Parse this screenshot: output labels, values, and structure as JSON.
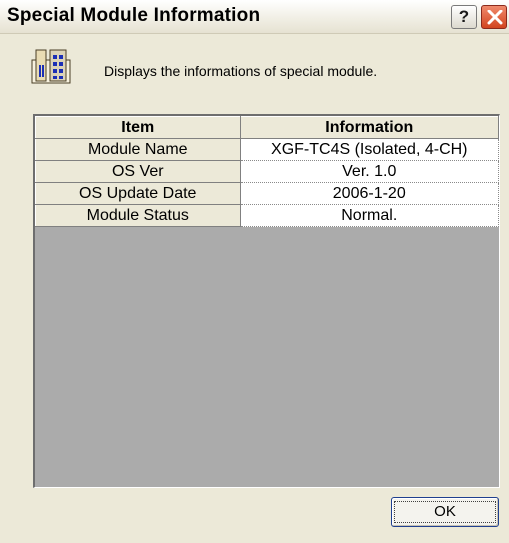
{
  "window": {
    "title": "Special Module Information",
    "help_glyph": "?",
    "close_icon": "close-icon"
  },
  "header": {
    "icon": "module-icon",
    "description": "Displays the informations of special module."
  },
  "table": {
    "columns": [
      "Item",
      "Information"
    ],
    "rows": [
      {
        "item": "Module Name",
        "info": "XGF-TC4S (Isolated, 4-CH)"
      },
      {
        "item": "OS Ver",
        "info": "Ver.  1.0"
      },
      {
        "item": "OS Update Date",
        "info": "2006-1-20"
      },
      {
        "item": "Module Status",
        "info": "Normal."
      }
    ]
  },
  "buttons": {
    "ok_label": "OK"
  },
  "colors": {
    "dialog_bg": "#ece9d8",
    "grid_bg": "#ababab",
    "close_red": "#d2441f",
    "ok_border": "#1f3f8f"
  }
}
